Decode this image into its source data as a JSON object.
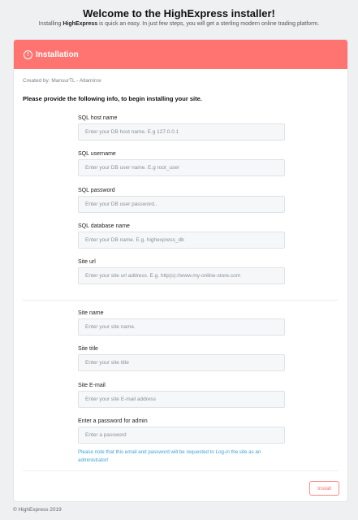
{
  "header": {
    "title": "Welcome to the HighExpress installer!",
    "subtitle_prefix": "Installing ",
    "subtitle_brand": "HighExpress",
    "subtitle_suffix": " is quick an easy. In just few steps, you will get a sterling modern online trading platform."
  },
  "card": {
    "title": "Installation",
    "title_icon": "info-icon",
    "created_by": "Created by: MansurTL - Altamirov",
    "intro": "Please provide the following info, to begin installing your site."
  },
  "db_fields": [
    {
      "label": "SQL host name",
      "placeholder": "Enter your DB host name. E.g 127.0.0.1",
      "value": ""
    },
    {
      "label": "SQL username",
      "placeholder": "Enter your DB user name. E.g root_user",
      "value": ""
    },
    {
      "label": "SQL password",
      "placeholder": "Enter your DB user password..",
      "value": ""
    },
    {
      "label": "SQL database name",
      "placeholder": "Enter your DB name. E.g. highexpress_db",
      "value": ""
    },
    {
      "label": "Site url",
      "placeholder": "Enter your site url address. E.g. http(s)://www.my-online-store.com",
      "value": ""
    }
  ],
  "site_fields": [
    {
      "label": "Site name",
      "placeholder": "Enter your site name.",
      "value": ""
    },
    {
      "label": "Site title",
      "placeholder": "Enter your site title",
      "value": ""
    },
    {
      "label": "Site E-mail",
      "placeholder": "Enter your site E-mail address",
      "value": ""
    },
    {
      "label": "Enter a password for admin",
      "placeholder": "Enter a password",
      "value": ""
    }
  ],
  "note": "Please note that this email and password will be requested to Log-in the site as an administrator!",
  "install_button": "Install",
  "footer": "© HighExpress 2019",
  "colors": {
    "header": "#ff7470",
    "note": "#3fa0d6",
    "button": "#ff6f6a"
  }
}
